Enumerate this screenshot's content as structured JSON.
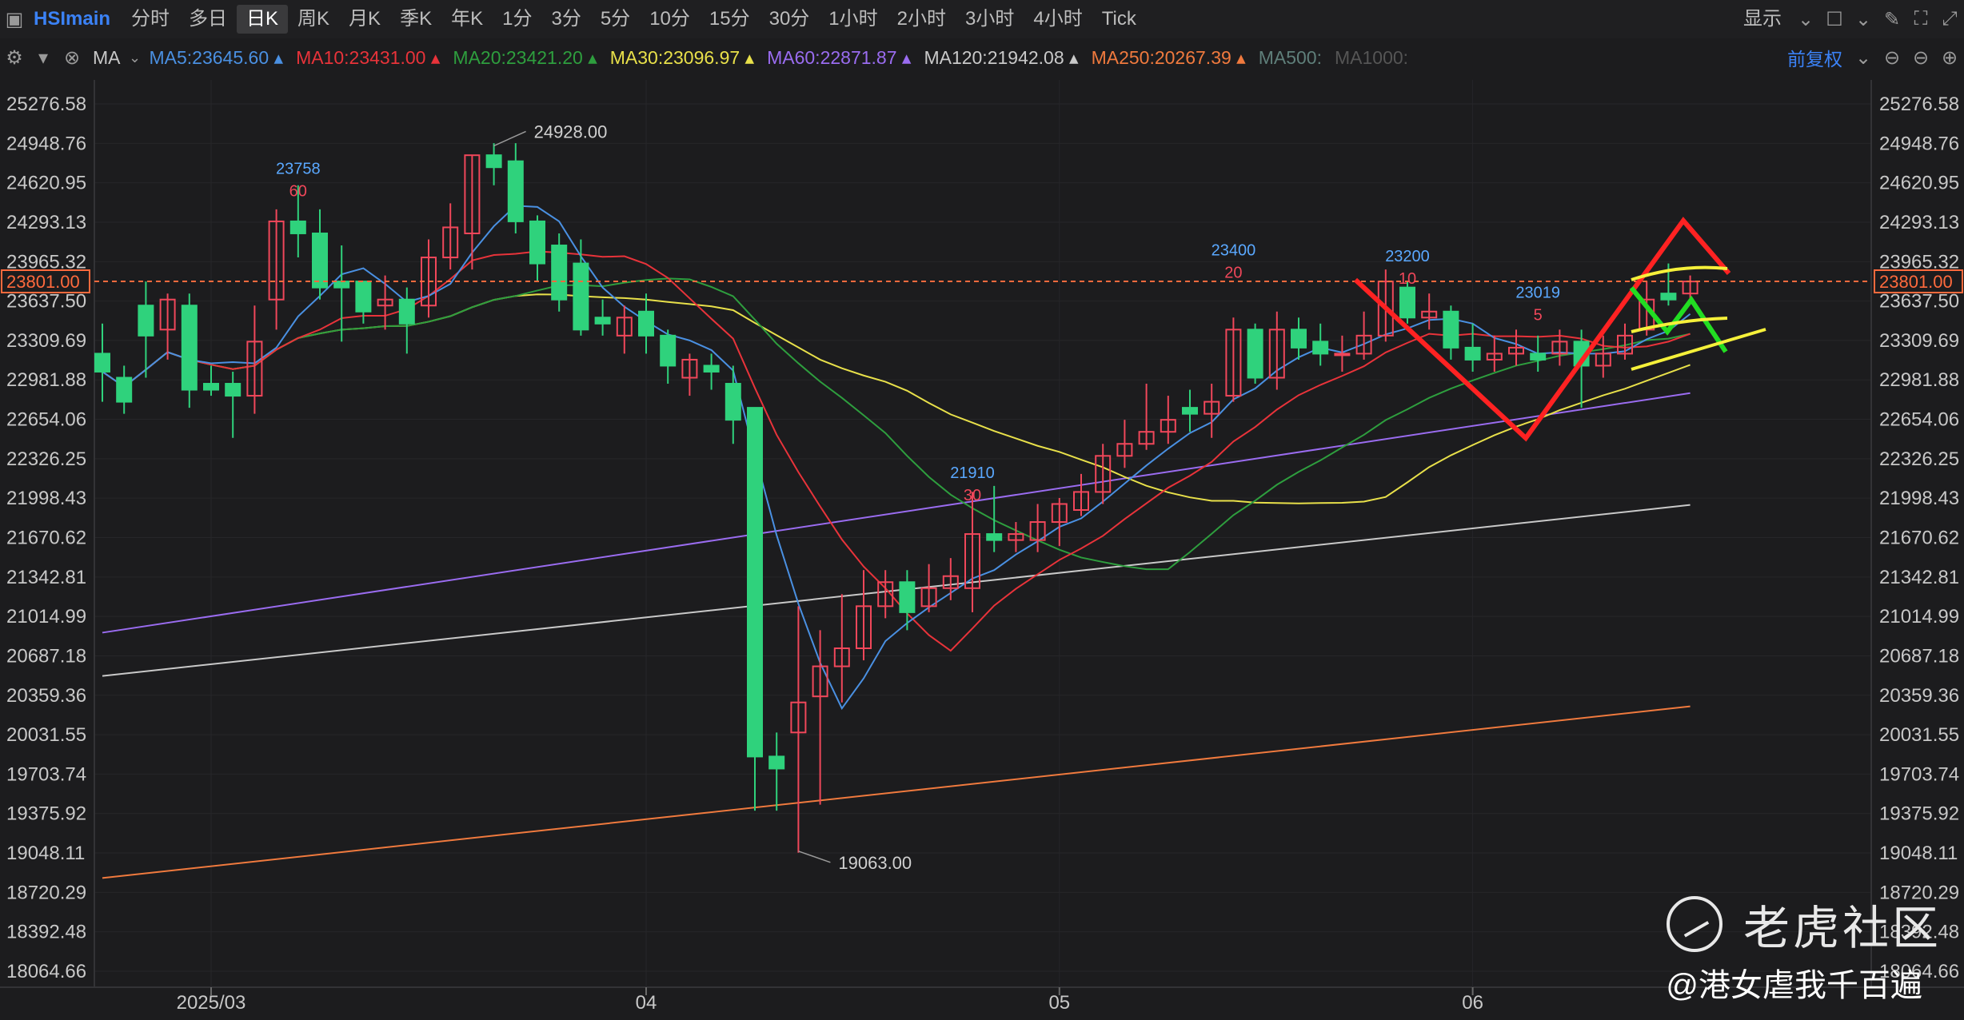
{
  "toolbar": {
    "symbol": "HSImain",
    "periods": [
      "分时",
      "多日",
      "日K",
      "周K",
      "月K",
      "季K",
      "年K",
      "1分",
      "3分",
      "5分",
      "10分",
      "15分",
      "30分",
      "1小时",
      "2小时",
      "3小时",
      "4小时",
      "Tick"
    ],
    "active_period": "日K",
    "display_label": "显示"
  },
  "ma_bar": {
    "indicator": "MA",
    "items": [
      {
        "label": "MA5:23645.60",
        "color": "#4a90e2"
      },
      {
        "label": "MA10:23431.00",
        "color": "#e8333a"
      },
      {
        "label": "MA20:23421.20",
        "color": "#2e9e3e"
      },
      {
        "label": "MA30:23096.97",
        "color": "#e8e04a"
      },
      {
        "label": "MA60:22871.87",
        "color": "#9a6cf0"
      },
      {
        "label": "MA120:21942.08",
        "color": "#c9c9c9"
      },
      {
        "label": "MA250:20267.39",
        "color": "#f07a3e"
      },
      {
        "label": "MA500:",
        "color": "#5f7f7a"
      },
      {
        "label": "MA1000:",
        "color": "#555555"
      }
    ],
    "adjust_label": "前复权"
  },
  "colors": {
    "up": "#f0475a",
    "down": "#2fd27c",
    "background": "#1c1c1e",
    "grid": "#262629",
    "price_line": "#ff6a3d"
  },
  "chart_data": {
    "type": "candlestick",
    "symbol": "HSImain",
    "period": "daily",
    "ylim": [
      18064.66,
      25276.58
    ],
    "y_ticks": [
      "25276.58",
      "24948.76",
      "24620.95",
      "24293.13",
      "23965.32",
      "23637.50",
      "23309.69",
      "22981.88",
      "22654.06",
      "22326.25",
      "21998.43",
      "21670.62",
      "21342.81",
      "21014.99",
      "20687.18",
      "20359.36",
      "20031.55",
      "19703.74",
      "19375.92",
      "19048.11",
      "18720.29",
      "18392.48",
      "18064.66"
    ],
    "x_labels": [
      {
        "label": "2025/03",
        "i": 5
      },
      {
        "label": "04",
        "i": 25
      },
      {
        "label": "05",
        "i": 44
      },
      {
        "label": "06",
        "i": 63
      }
    ],
    "last_price": "23801.00",
    "candles": [
      [
        23200,
        23050,
        23450,
        22800
      ],
      [
        23000,
        22800,
        23100,
        22700
      ],
      [
        23600,
        23350,
        23800,
        23000
      ],
      [
        23400,
        23650,
        23700,
        23150
      ],
      [
        23600,
        22900,
        23700,
        22750
      ],
      [
        22950,
        22900,
        23100,
        22850
      ],
      [
        22950,
        22850,
        23050,
        22500
      ],
      [
        22850,
        23300,
        23600,
        22700
      ],
      [
        23650,
        24300,
        24400,
        23400
      ],
      [
        24300,
        24200,
        24600,
        24000
      ],
      [
        24200,
        23750,
        24400,
        23650
      ],
      [
        23800,
        23750,
        24100,
        23300
      ],
      [
        23800,
        23550,
        23800,
        23450
      ],
      [
        23600,
        23650,
        23850,
        23400
      ],
      [
        23650,
        23450,
        23750,
        23200
      ],
      [
        23600,
        24000,
        24150,
        23500
      ],
      [
        24000,
        24250,
        24450,
        23900
      ],
      [
        24200,
        24850,
        24850,
        23900
      ],
      [
        24850,
        24750,
        24950,
        24600
      ],
      [
        24800,
        24300,
        24950,
        24200
      ],
      [
        24300,
        23950,
        24350,
        23800
      ],
      [
        24100,
        23650,
        24200,
        23550
      ],
      [
        23950,
        23400,
        24150,
        23350
      ],
      [
        23500,
        23450,
        23650,
        23350
      ],
      [
        23350,
        23500,
        23600,
        23200
      ],
      [
        23550,
        23350,
        23700,
        23200
      ],
      [
        23350,
        23100,
        23400,
        22950
      ],
      [
        23000,
        23150,
        23200,
        22850
      ],
      [
        23100,
        23050,
        23200,
        22900
      ],
      [
        22950,
        22650,
        23100,
        22450
      ],
      [
        22750,
        19850,
        22750,
        19400
      ],
      [
        19850,
        19750,
        20050,
        19400
      ],
      [
        20050,
        20300,
        21100,
        19050
      ],
      [
        20350,
        20600,
        20900,
        19450
      ],
      [
        20600,
        20750,
        21200,
        20300
      ],
      [
        20750,
        21100,
        21400,
        20650
      ],
      [
        21100,
        21300,
        21400,
        21000
      ],
      [
        21300,
        21050,
        21400,
        20900
      ],
      [
        21100,
        21250,
        21450,
        21050
      ],
      [
        21250,
        21350,
        21500,
        21150
      ],
      [
        21250,
        21700,
        22050,
        21050
      ],
      [
        21700,
        21650,
        22100,
        21550
      ],
      [
        21650,
        21700,
        21800,
        21550
      ],
      [
        21650,
        21800,
        21950,
        21550
      ],
      [
        21800,
        21950,
        22000,
        21600
      ],
      [
        21900,
        22050,
        22200,
        21850
      ],
      [
        22050,
        22350,
        22450,
        21950
      ],
      [
        22350,
        22450,
        22650,
        22250
      ],
      [
        22450,
        22550,
        22950,
        22400
      ],
      [
        22550,
        22650,
        22850,
        22450
      ],
      [
        22750,
        22700,
        22900,
        22550
      ],
      [
        22700,
        22800,
        22950,
        22500
      ],
      [
        22850,
        23400,
        23500,
        22800
      ],
      [
        23400,
        23000,
        23450,
        22950
      ],
      [
        23000,
        23400,
        23550,
        22900
      ],
      [
        23400,
        23250,
        23500,
        23150
      ],
      [
        23300,
        23200,
        23450,
        23100
      ],
      [
        23200,
        23200,
        23350,
        23050
      ],
      [
        23200,
        23350,
        23550,
        23150
      ],
      [
        23350,
        23800,
        23900,
        23300
      ],
      [
        23750,
        23500,
        23800,
        23450
      ],
      [
        23500,
        23550,
        23700,
        23400
      ],
      [
        23550,
        23250,
        23600,
        23150
      ],
      [
        23250,
        23150,
        23450,
        23050
      ],
      [
        23150,
        23200,
        23350,
        23050
      ],
      [
        23200,
        23250,
        23400,
        23100
      ],
      [
        23200,
        23150,
        23350,
        23050
      ],
      [
        23200,
        23300,
        23400,
        23100
      ],
      [
        23300,
        23100,
        23400,
        22750
      ],
      [
        23100,
        23200,
        23350,
        23000
      ],
      [
        23200,
        23350,
        23450,
        23150
      ],
      [
        23400,
        23650,
        23800,
        23350
      ],
      [
        23700,
        23650,
        23950,
        23600
      ],
      [
        23700,
        23800,
        23850,
        23650
      ]
    ],
    "annotations": [
      {
        "text": "23758",
        "sub": "60",
        "i": 9,
        "v": 24430
      },
      {
        "text": "24928.00",
        "i": 18,
        "v": 24928
      },
      {
        "text": "19063.00",
        "i": 32,
        "v": 19063
      },
      {
        "text": "21910",
        "sub": "30",
        "i": 40,
        "v": 21900
      },
      {
        "text": "23400",
        "sub": "20",
        "i": 52,
        "v": 23750
      },
      {
        "text": "23200",
        "sub": "10",
        "i": 60,
        "v": 23700
      },
      {
        "text": "23019",
        "sub": "5",
        "i": 66,
        "v": 23400
      }
    ]
  },
  "watermark": "老虎社区",
  "author": "@港女虐我千百遍"
}
